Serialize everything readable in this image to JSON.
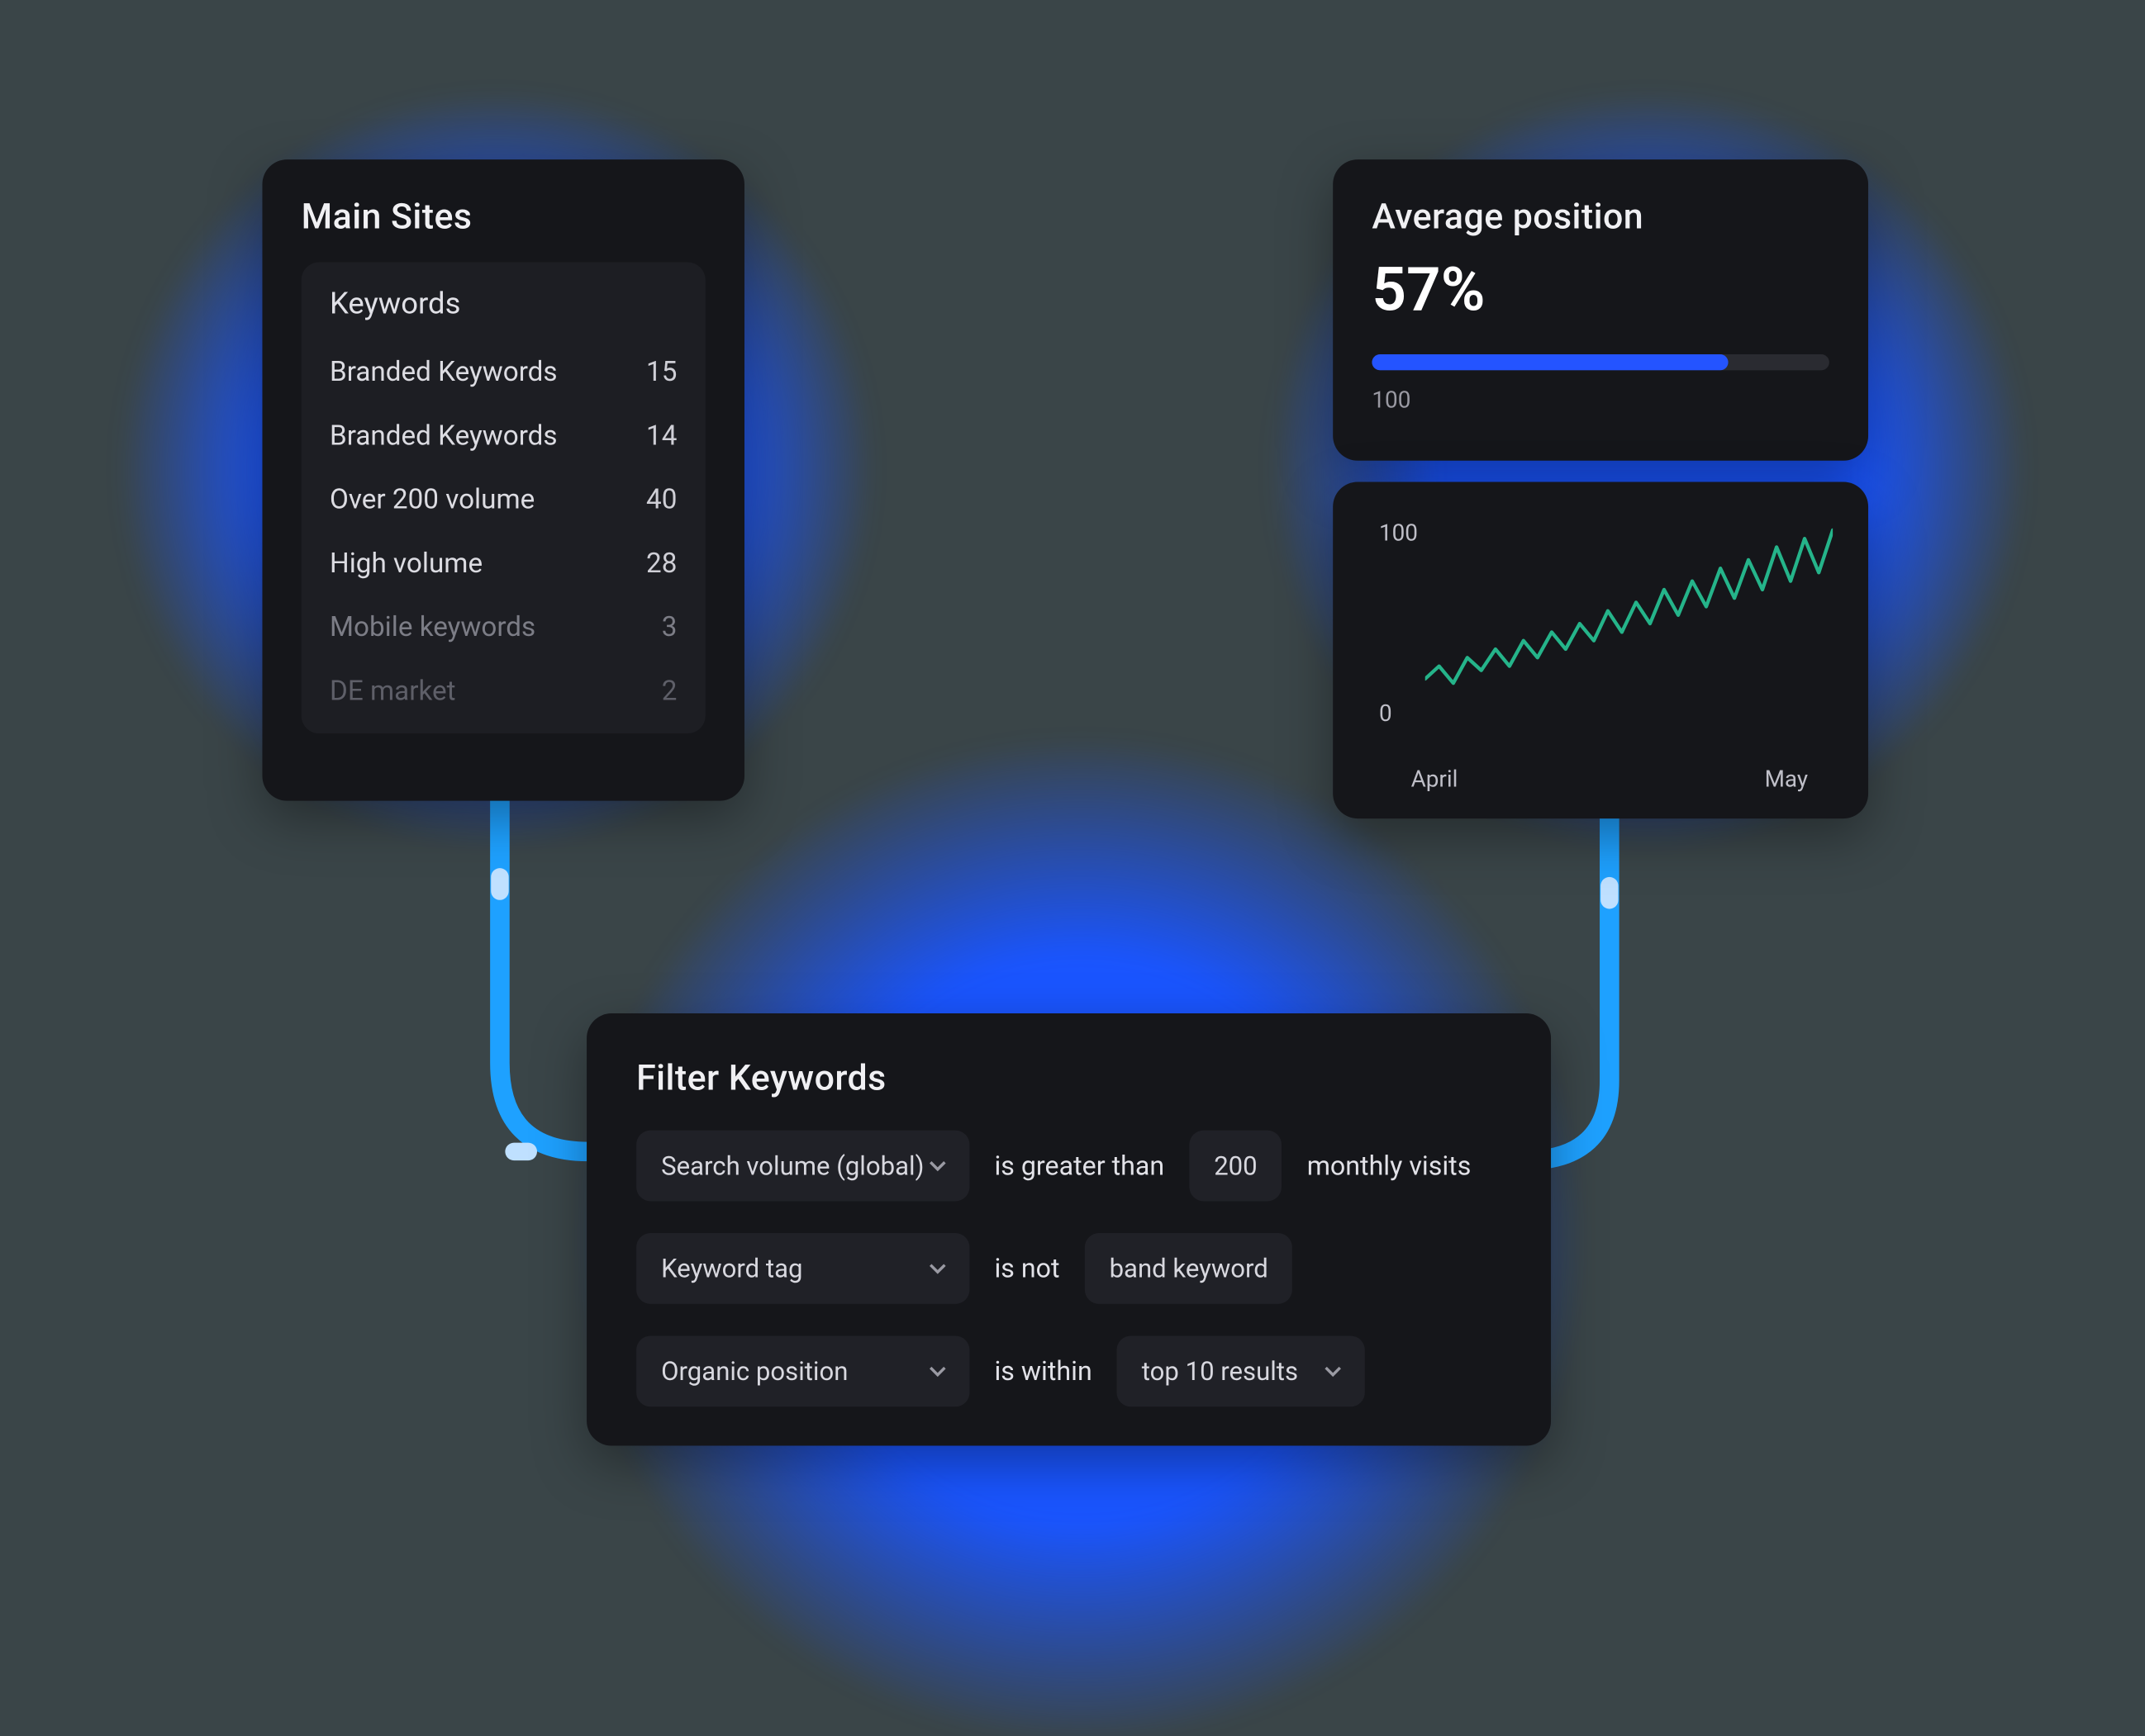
{
  "main_sites": {
    "title": "Main Sites",
    "panel_heading": "Keywords",
    "rows": [
      {
        "label": "Branded Keywords",
        "count": "15"
      },
      {
        "label": "Branded Keywords",
        "count": "14"
      },
      {
        "label": "Over 200 volume",
        "count": "40"
      },
      {
        "label": "High volume",
        "count": "28"
      },
      {
        "label": "Mobile keywords",
        "count": "3"
      },
      {
        "label": "DE market",
        "count": "2"
      }
    ]
  },
  "avg_position": {
    "title": "Average position",
    "value": "57%",
    "progress_pct": 78,
    "scale_label": "100"
  },
  "chart": {
    "y_top": "100",
    "y_bottom": "0",
    "x_start": "April",
    "x_end": "May"
  },
  "chart_data": {
    "type": "line",
    "title": "",
    "xlabel": "",
    "ylabel": "",
    "ylim": [
      0,
      100
    ],
    "x_range_labels": [
      "April",
      "May"
    ],
    "series": [
      {
        "name": "trend",
        "values": [
          24,
          30,
          22,
          34,
          28,
          38,
          30,
          42,
          34,
          46,
          38,
          50,
          42,
          56,
          46,
          60,
          50,
          66,
          54,
          70,
          58,
          76,
          62,
          80,
          66,
          86,
          70,
          90,
          74,
          94
        ]
      }
    ]
  },
  "filter": {
    "title": "Filter Keywords",
    "row1": {
      "field": "Search volume (global)",
      "op": "is greater than",
      "value": "200",
      "suffix": "monthly visits"
    },
    "row2": {
      "field": "Keyword tag",
      "op": "is not",
      "value": "band keyword"
    },
    "row3": {
      "field": "Organic position",
      "op": "is within",
      "value": "top 10 results"
    }
  }
}
